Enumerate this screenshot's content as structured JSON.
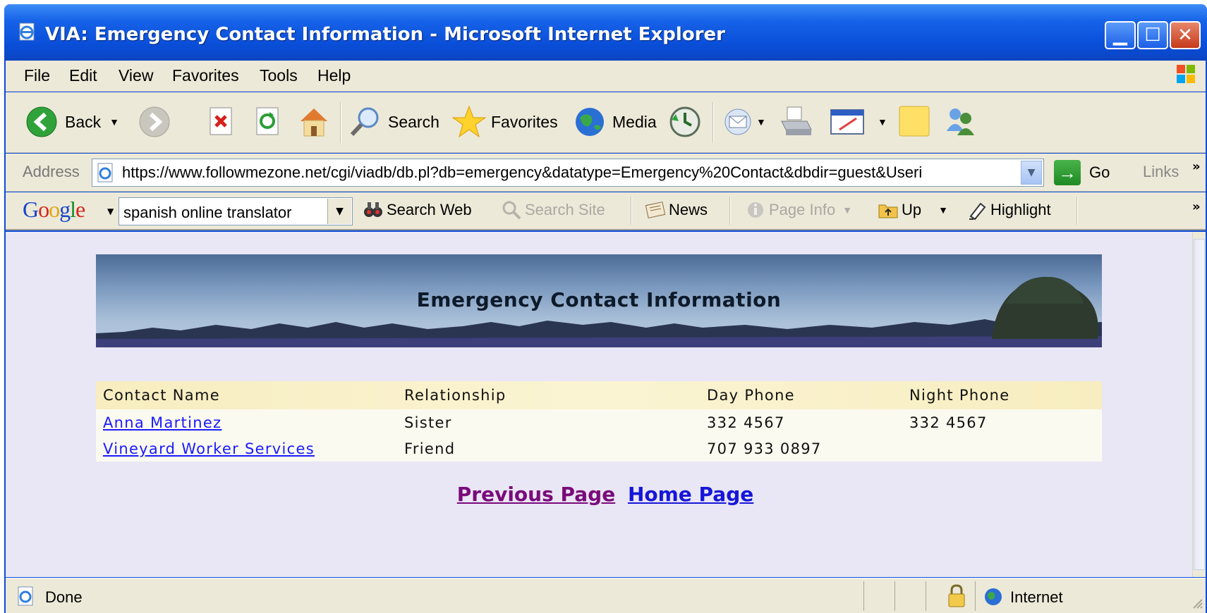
{
  "window": {
    "title": "VIA: Emergency Contact Information - Microsoft Internet Explorer"
  },
  "menu": [
    "File",
    "Edit",
    "View",
    "Favorites",
    "Tools",
    "Help"
  ],
  "toolbar": {
    "back": "Back",
    "search": "Search",
    "favorites": "Favorites",
    "media": "Media"
  },
  "address": {
    "label": "Address",
    "url": "https://www.followmezone.net/cgi/viadb/db.pl?db=emergency&datatype=Emergency%20Contact&dbdir=guest&Useri",
    "go": "Go",
    "links": "Links"
  },
  "google": {
    "search_value": "spanish online translator",
    "search_web": "Search Web",
    "search_site": "Search Site",
    "news": "News",
    "page_info": "Page Info",
    "up": "Up",
    "highlight": "Highlight"
  },
  "page": {
    "banner_title": "Emergency Contact Information",
    "columns": [
      "Contact Name",
      "Relationship",
      "Day Phone",
      "Night Phone"
    ],
    "rows": [
      {
        "name": "Anna Martinez",
        "relationship": "Sister",
        "day_phone": "332 4567",
        "night_phone": "332 4567"
      },
      {
        "name": "Vineyard Worker Services",
        "relationship": "Friend",
        "day_phone": "707 933 0897",
        "night_phone": ""
      }
    ],
    "previous_page": "Previous Page",
    "home_page": "Home Page"
  },
  "status": {
    "text": "Done",
    "zone": "Internet"
  },
  "colors": {
    "titlebar": "#0a4fd9",
    "chrome": "#ece9d8",
    "content_bg": "#e9e6f5",
    "link_visited": "#7a0a7a",
    "link": "#1616d8"
  }
}
